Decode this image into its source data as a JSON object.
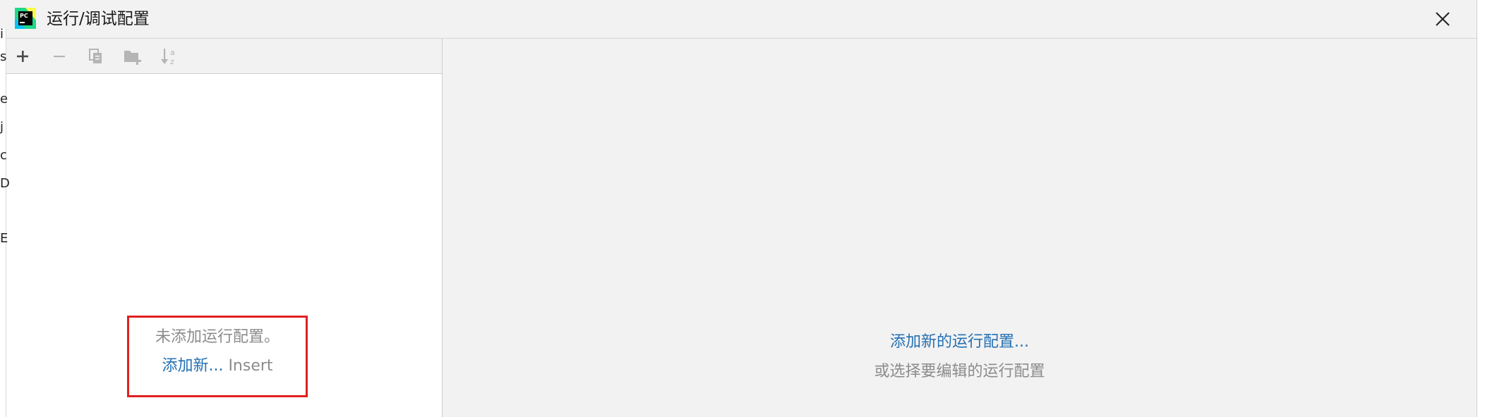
{
  "window": {
    "title": "运行/调试配置",
    "close_icon": "close-icon"
  },
  "toolbar": {
    "buttons": [
      {
        "name": "add",
        "icon": "plus-icon",
        "enabled": true
      },
      {
        "name": "remove",
        "icon": "minus-icon",
        "enabled": false
      },
      {
        "name": "copy",
        "icon": "copy-icon",
        "enabled": false
      },
      {
        "name": "move-to-folder",
        "icon": "folder-add-icon",
        "enabled": false
      },
      {
        "name": "sort",
        "icon": "sort-alpha-icon",
        "enabled": false
      }
    ]
  },
  "left_panel": {
    "empty_message": "未添加运行配置。",
    "add_link": "添加新...",
    "add_shortcut": "Insert"
  },
  "right_panel": {
    "add_link": "添加新的运行配置...",
    "hint": "或选择要编辑的运行配置"
  },
  "background_fragments": [
    "i",
    "s",
    "e",
    "j",
    "c",
    "D",
    "E"
  ],
  "colors": {
    "link": "#2470b3",
    "muted_text": "#8c8c8c",
    "highlight_box": "#e02020",
    "pycharm_green": "#21d789"
  }
}
